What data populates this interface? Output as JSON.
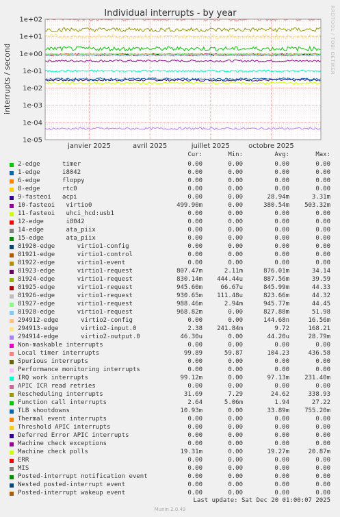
{
  "chart_data": {
    "type": "line",
    "title": "Individual interrupts - by year",
    "ylabel": "interrupts / second",
    "yscale": "log",
    "ylim": [
      1e-05,
      100
    ],
    "yticks": [
      "1e+02",
      "1e+01",
      "1e+00",
      "1e-01",
      "1e-02",
      "1e-03",
      "1e-04",
      "1e-05"
    ],
    "xticks": [
      "janvier 2025",
      "avril 2025",
      "juillet 2025",
      "octobre 2025"
    ],
    "grid": true,
    "side_label": "RRDTOOL / TOBI OETIKER",
    "columns": [
      "Cur:",
      "Min:",
      "Avg:",
      "Max:"
    ],
    "series": [
      {
        "name": "2-edge      timer",
        "color": "#00cc00",
        "cur": "0.00",
        "min": "0.00",
        "avg": "0.00",
        "max": "0.00"
      },
      {
        "name": "1-edge      i8042",
        "color": "#0066b3",
        "cur": "0.00",
        "min": "0.00",
        "avg": "0.00",
        "max": "0.00"
      },
      {
        "name": "6-edge      floppy",
        "color": "#ff8000",
        "cur": "0.00",
        "min": "0.00",
        "avg": "0.00",
        "max": "0.00"
      },
      {
        "name": "8-edge      rtc0",
        "color": "#ffcc00",
        "cur": "0.00",
        "min": "0.00",
        "avg": "0.00",
        "max": "0.00"
      },
      {
        "name": "9-fasteoi   acpi",
        "color": "#330099",
        "cur": "0.00",
        "min": "0.00",
        "avg": "28.94m",
        "max": "3.31m"
      },
      {
        "name": "10-fasteoi   virtio0",
        "color": "#990099",
        "cur": "499.90m",
        "min": "0.00",
        "avg": "380.54m",
        "max": "503.32m"
      },
      {
        "name": "11-fasteoi   uhci_hcd:usb1",
        "color": "#ccff00",
        "cur": "0.00",
        "min": "0.00",
        "avg": "0.00",
        "max": "0.00"
      },
      {
        "name": "12-edge      i8042",
        "color": "#ff0000",
        "cur": "0.00",
        "min": "0.00",
        "avg": "0.00",
        "max": "0.00"
      },
      {
        "name": "14-edge      ata_piix",
        "color": "#808080",
        "cur": "0.00",
        "min": "0.00",
        "avg": "0.00",
        "max": "0.00"
      },
      {
        "name": "15-edge      ata_piix",
        "color": "#008f00",
        "cur": "0.00",
        "min": "0.00",
        "avg": "0.00",
        "max": "0.00"
      },
      {
        "name": "81920-edge      virtio1-config",
        "color": "#00487d",
        "cur": "0.00",
        "min": "0.00",
        "avg": "0.00",
        "max": "0.00"
      },
      {
        "name": "81921-edge      virtio1-control",
        "color": "#b35a00",
        "cur": "0.00",
        "min": "0.00",
        "avg": "0.00",
        "max": "0.00"
      },
      {
        "name": "81922-edge      virtio1-event",
        "color": "#b38f00",
        "cur": "0.00",
        "min": "0.00",
        "avg": "0.00",
        "max": "0.00"
      },
      {
        "name": "81923-edge      virtio1-request",
        "color": "#6b006b",
        "cur": "807.47m",
        "min": "2.11m",
        "avg": "876.01m",
        "max": "34.14"
      },
      {
        "name": "81924-edge      virtio1-request",
        "color": "#8fb300",
        "cur": "830.14m",
        "min": "444.44u",
        "avg": "887.56m",
        "max": "39.59"
      },
      {
        "name": "81925-edge      virtio1-request",
        "color": "#b30000",
        "cur": "945.60m",
        "min": "66.67u",
        "avg": "845.99m",
        "max": "44.33"
      },
      {
        "name": "81926-edge      virtio1-request",
        "color": "#bebebe",
        "cur": "930.65m",
        "min": "111.48u",
        "avg": "823.66m",
        "max": "44.32"
      },
      {
        "name": "81927-edge      virtio1-request",
        "color": "#80ff80",
        "cur": "988.46m",
        "min": "2.94m",
        "avg": "945.77m",
        "max": "44.45"
      },
      {
        "name": "81928-edge      virtio1-request",
        "color": "#80c9ff",
        "cur": "968.82m",
        "min": "0.00",
        "avg": "827.88m",
        "max": "51.98"
      },
      {
        "name": "294912-edge      virtio2-config",
        "color": "#ffc080",
        "cur": "0.00",
        "min": "0.00",
        "avg": "144.68n",
        "max": "16.56m"
      },
      {
        "name": "294913-edge      virtio2-input.0",
        "color": "#ffe680",
        "cur": "2.38",
        "min": "241.84m",
        "avg": "9.72",
        "max": "168.21"
      },
      {
        "name": "294914-edge      virtio2-output.0",
        "color": "#aa80ff",
        "cur": "46.30u",
        "min": "0.00",
        "avg": "44.20u",
        "max": "28.79m"
      },
      {
        "name": "Non-maskable interrupts",
        "color": "#ee00cc",
        "cur": "0.00",
        "min": "0.00",
        "avg": "0.00",
        "max": "0.00"
      },
      {
        "name": "Local timer interrupts",
        "color": "#ff8080",
        "cur": "99.89",
        "min": "59.87",
        "avg": "104.23",
        "max": "436.58"
      },
      {
        "name": "Spurious interrupts",
        "color": "#666600",
        "cur": "0.00",
        "min": "0.00",
        "avg": "0.00",
        "max": "0.00"
      },
      {
        "name": "Performance monitoring interrupts",
        "color": "#ffbfff",
        "cur": "0.00",
        "min": "0.00",
        "avg": "0.00",
        "max": "0.00"
      },
      {
        "name": "IRQ work interrupts",
        "color": "#00ffcc",
        "cur": "99.12m",
        "min": "0.00",
        "avg": "97.13m",
        "max": "231.40m"
      },
      {
        "name": "APIC ICR read retries",
        "color": "#cc6699",
        "cur": "0.00",
        "min": "0.00",
        "avg": "0.00",
        "max": "0.00"
      },
      {
        "name": "Rescheduling interrupts",
        "color": "#999900",
        "cur": "31.69",
        "min": "7.29",
        "avg": "24.62",
        "max": "338.93"
      },
      {
        "name": "Function call interrupts",
        "color": "#00cc00",
        "cur": "2.64",
        "min": "5.06m",
        "avg": "1.94",
        "max": "27.22"
      },
      {
        "name": "TLB shootdowns",
        "color": "#0066b3",
        "cur": "10.93m",
        "min": "0.00",
        "avg": "33.89m",
        "max": "755.20m"
      },
      {
        "name": "Thermal event interrupts",
        "color": "#ff8000",
        "cur": "0.00",
        "min": "0.00",
        "avg": "0.00",
        "max": "0.00"
      },
      {
        "name": "Threshold APIC interrupts",
        "color": "#ffcc00",
        "cur": "0.00",
        "min": "0.00",
        "avg": "0.00",
        "max": "0.00"
      },
      {
        "name": "Deferred Error APIC interrupts",
        "color": "#330099",
        "cur": "0.00",
        "min": "0.00",
        "avg": "0.00",
        "max": "0.00"
      },
      {
        "name": "Machine check exceptions",
        "color": "#990099",
        "cur": "0.00",
        "min": "0.00",
        "avg": "0.00",
        "max": "0.00"
      },
      {
        "name": "Machine check polls",
        "color": "#ccff00",
        "cur": "19.31m",
        "min": "0.00",
        "avg": "19.27m",
        "max": "20.87m"
      },
      {
        "name": "ERR",
        "color": "#ff0000",
        "cur": "0.00",
        "min": "0.00",
        "avg": "0.00",
        "max": "0.00"
      },
      {
        "name": "MIS",
        "color": "#808080",
        "cur": "0.00",
        "min": "0.00",
        "avg": "0.00",
        "max": "0.00"
      },
      {
        "name": "Posted-interrupt notification event",
        "color": "#008f00",
        "cur": "0.00",
        "min": "0.00",
        "avg": "0.00",
        "max": "0.00"
      },
      {
        "name": "Nested posted-interrupt event",
        "color": "#00487d",
        "cur": "0.00",
        "min": "0.00",
        "avg": "0.00",
        "max": "0.00"
      },
      {
        "name": "Posted-interrupt wakeup event",
        "color": "#b35a00",
        "cur": "0.00",
        "min": "0.00",
        "avg": "0.00",
        "max": "0.00"
      }
    ]
  },
  "footer": {
    "last_update": "Last update: Sat Dec 20 01:00:07 2025",
    "generator": "Munin 2.0.49"
  }
}
